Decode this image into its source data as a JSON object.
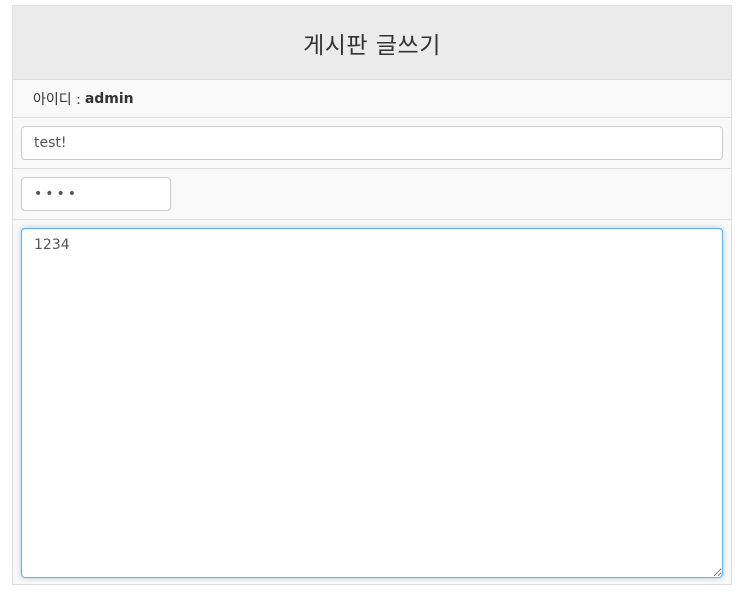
{
  "form": {
    "title": "게시판 글쓰기",
    "user_id_label": "아이디 :",
    "user_id_value": "admin",
    "subject_value": "test!",
    "password_value": "1234",
    "content_value": "1234"
  }
}
